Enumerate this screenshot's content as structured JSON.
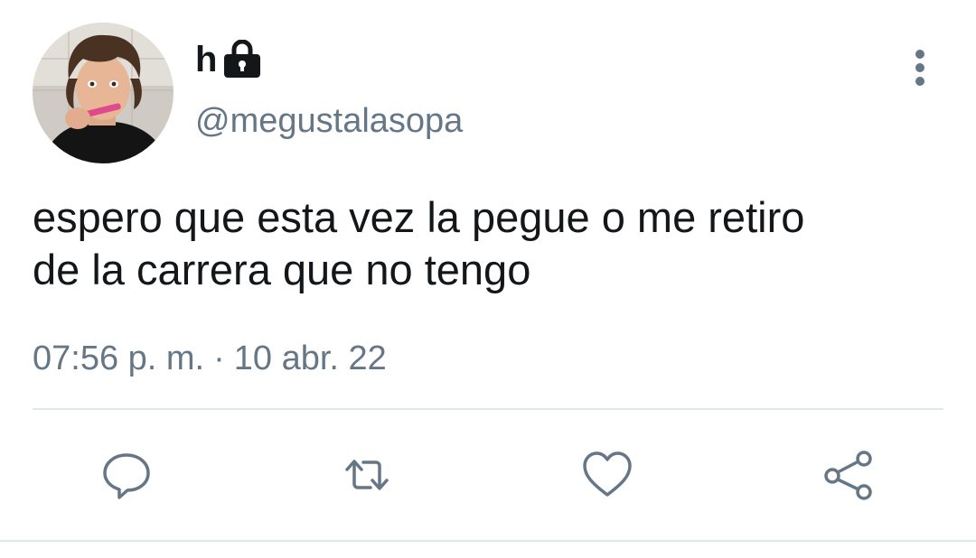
{
  "user": {
    "display_name": "h",
    "handle": "@megustalasopa",
    "protected_icon": "lock-icon",
    "avatar": "avatar"
  },
  "tweet": {
    "text": "espero que esta vez la pegue o me retiro\nde la carrera que no tengo",
    "time": "07:56 p. m.",
    "separator": "·",
    "date": "10 abr. 22"
  },
  "actions": [
    {
      "icon": "reply-icon"
    },
    {
      "icon": "retweet-icon"
    },
    {
      "icon": "like-icon"
    },
    {
      "icon": "share-icon"
    }
  ],
  "menu": {
    "icon": "more-vertical-icon"
  },
  "colors": {
    "text": "#14171a",
    "secondary": "#657786",
    "icon": "#657786",
    "divider": "#e1e8ed"
  }
}
